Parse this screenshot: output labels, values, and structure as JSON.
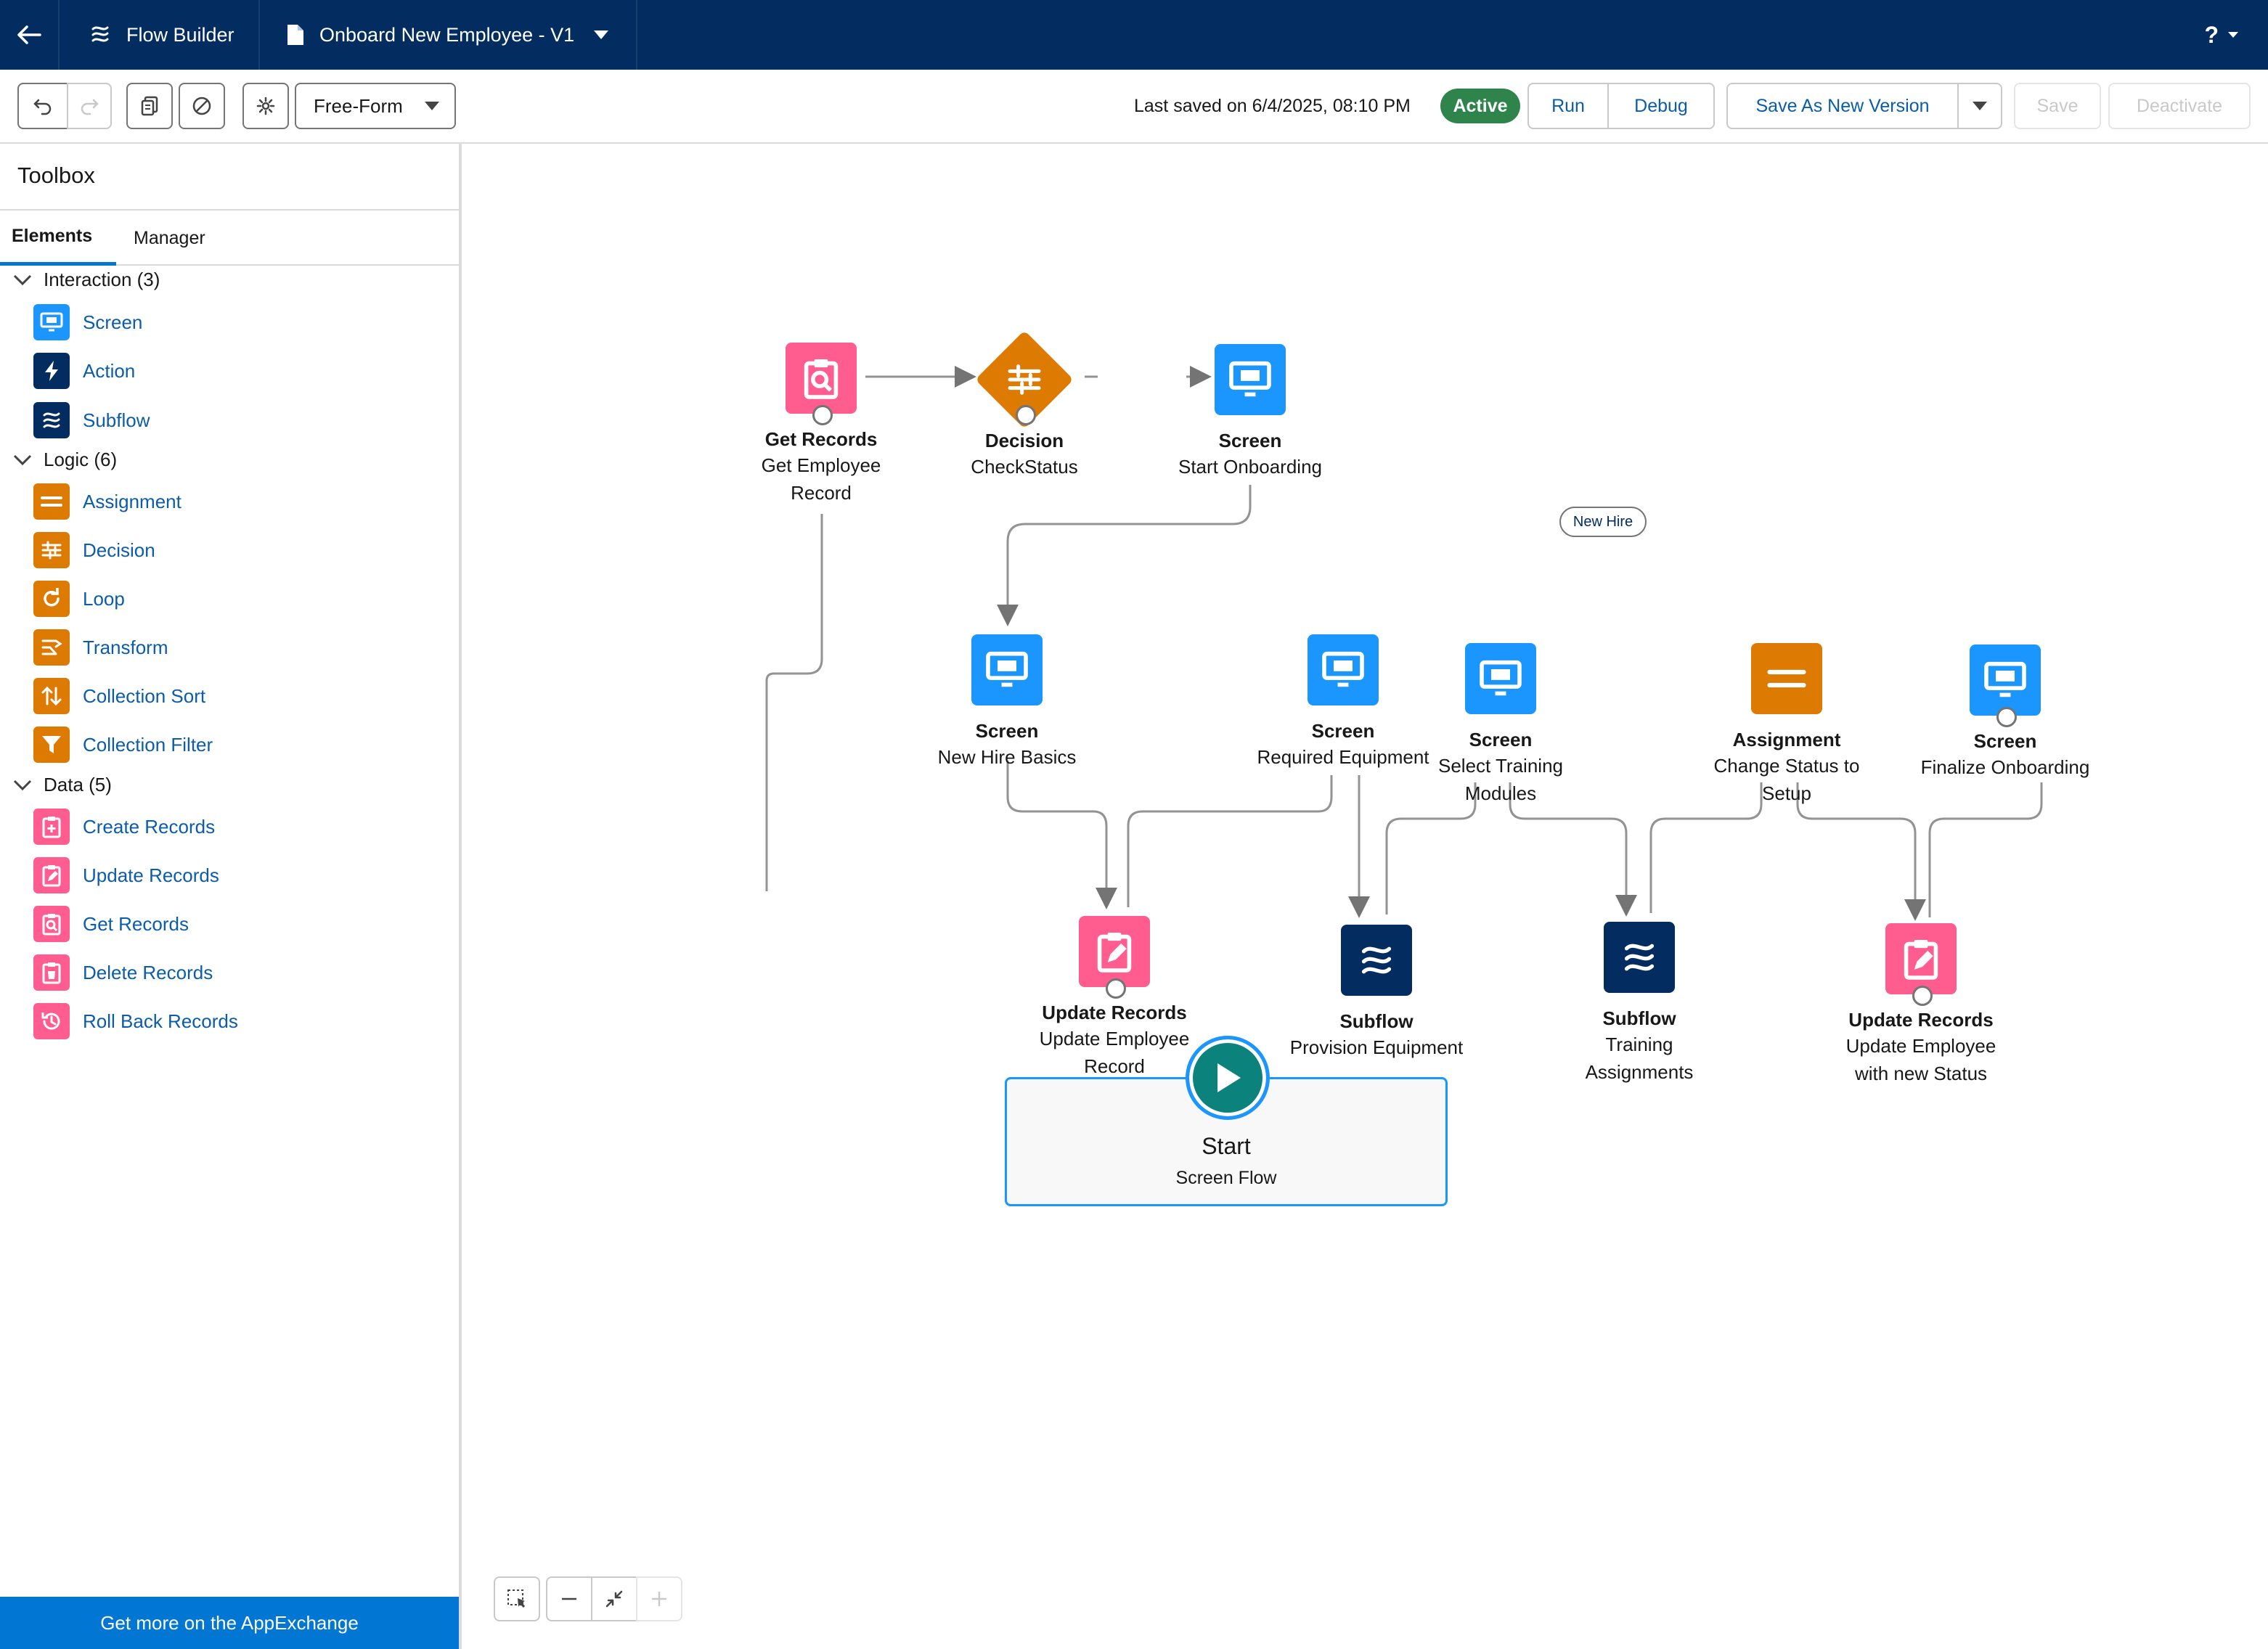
{
  "topbar": {
    "app_name": "Flow Builder",
    "flow_name": "Onboard New Employee - V1",
    "help_label": "?"
  },
  "toolbar": {
    "layout_select": "Free-Form",
    "last_saved": "Last saved on 6/4/2025, 08:10 PM",
    "status_badge": "Active",
    "run_label": "Run",
    "debug_label": "Debug",
    "save_as_new_label": "Save As New Version",
    "save_label": "Save",
    "deactivate_label": "Deactivate"
  },
  "toolbox": {
    "title": "Toolbox",
    "tabs": [
      {
        "label": "Elements",
        "active": true
      },
      {
        "label": "Manager",
        "active": false
      }
    ],
    "groups": [
      {
        "label": "Interaction (3)",
        "items": [
          {
            "label": "Screen",
            "icon": "screen-icon",
            "color": "#1b96ff"
          },
          {
            "label": "Action",
            "icon": "lightning-icon",
            "color": "#032d60"
          },
          {
            "label": "Subflow",
            "icon": "flow-icon",
            "color": "#032d60"
          }
        ]
      },
      {
        "label": "Logic (6)",
        "items": [
          {
            "label": "Assignment",
            "icon": "equals-icon",
            "color": "#dd7a01"
          },
          {
            "label": "Decision",
            "icon": "decision-icon",
            "color": "#dd7a01"
          },
          {
            "label": "Loop",
            "icon": "loop-icon",
            "color": "#dd7a01"
          },
          {
            "label": "Transform",
            "icon": "transform-icon",
            "color": "#dd7a01"
          },
          {
            "label": "Collection Sort",
            "icon": "sort-icon",
            "color": "#dd7a01"
          },
          {
            "label": "Collection Filter",
            "icon": "filter-icon",
            "color": "#dd7a01"
          }
        ]
      },
      {
        "label": "Data (5)",
        "items": [
          {
            "label": "Create Records",
            "icon": "record-create-icon",
            "color": "#ff5d8f"
          },
          {
            "label": "Update Records",
            "icon": "record-update-icon",
            "color": "#ff5d8f"
          },
          {
            "label": "Get Records",
            "icon": "record-lookup-icon",
            "color": "#ff5d8f"
          },
          {
            "label": "Delete Records",
            "icon": "record-delete-icon",
            "color": "#ff5d8f"
          },
          {
            "label": "Roll Back Records",
            "icon": "rollback-icon",
            "color": "#ff5d8f"
          }
        ]
      }
    ],
    "appexchange_label": "Get more on the AppExchange"
  },
  "canvas": {
    "start": {
      "title": "Start",
      "subtitle": "Screen Flow"
    },
    "connector_label": "New Hire",
    "nodes": {
      "get_records": {
        "type": "Get Records",
        "label": "Get Employee Record"
      },
      "decision": {
        "type": "Decision",
        "label": "CheckStatus"
      },
      "screen_start": {
        "type": "Screen",
        "label": "Start Onboarding"
      },
      "screen_basics": {
        "type": "Screen",
        "label": "New Hire Basics"
      },
      "screen_equipment": {
        "type": "Screen",
        "label": "Required Equipment"
      },
      "screen_training": {
        "type": "Screen",
        "label": "Select Training Modules"
      },
      "assignment": {
        "type": "Assignment",
        "label": "Change Status to Setup"
      },
      "screen_finalize": {
        "type": "Screen",
        "label": "Finalize Onboarding"
      },
      "update_employee": {
        "type": "Update Records",
        "label": "Update Employee Record"
      },
      "subflow_equipment": {
        "type": "Subflow",
        "label": "Provision Equipment"
      },
      "subflow_training": {
        "type": "Subflow",
        "label": "Training Assignments"
      },
      "update_status": {
        "type": "Update Records",
        "label": "Update Employee with new Status"
      }
    }
  }
}
